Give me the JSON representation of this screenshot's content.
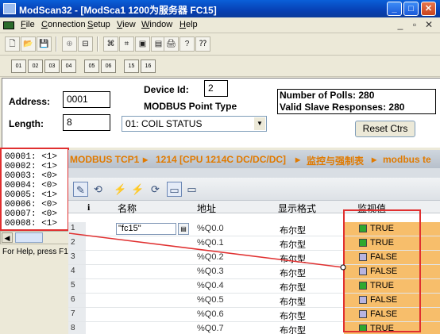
{
  "modscan": {
    "title": "ModScan32 - [ModSca1 1200为服务器 FC15]",
    "window_buttons": {
      "minimize": "_",
      "maximize": "□",
      "close": "✕"
    },
    "menu": [
      "File",
      "Connection",
      "Setup",
      "View",
      "Window",
      "Help"
    ],
    "mdi_controls": [
      "_",
      "▫",
      "✕"
    ],
    "toolbar1": [
      "🗋",
      "📂",
      "💾",
      "⊕",
      "⊟",
      "⌘",
      "⌗",
      "▣",
      "▤",
      "🖨",
      "?",
      "⁇"
    ],
    "toolbar2": [
      "01",
      "02",
      "03",
      "04",
      "05",
      "06",
      "15",
      "16"
    ],
    "address_label": "Address:",
    "address_value": "0001",
    "length_label": "Length:",
    "length_value": "8",
    "device_id_label": "Device Id:",
    "device_id_value": "2",
    "point_type_label": "MODBUS Point Type",
    "point_type_value": "01: COIL STATUS",
    "polls_label": "Number of Polls: 280",
    "valid_label": "Valid Slave Responses: 280",
    "reset_label": "Reset Ctrs",
    "coils": [
      "00001: <1>",
      "00002: <1>",
      "00003: <0>",
      "00004: <0>",
      "00005: <1>",
      "00006: <0>",
      "00007: <0>",
      "00008: <1>"
    ],
    "status_text": "For Help, press F1"
  },
  "tia": {
    "breadcrumb": [
      "MODBUS TCP1",
      "▸",
      "1214 [CPU 1214C DC/DC/DC]",
      "▸",
      "监控与强制表",
      "▸",
      "modbus te"
    ],
    "toolbar_icons": [
      "✎",
      "⟲",
      "⚡",
      "⚡",
      "⟳",
      "▭",
      "▭"
    ],
    "headers": {
      "info": "i",
      "name": "名称",
      "address": "地址",
      "format": "显示格式",
      "monitor": "监视值"
    },
    "rows": [
      {
        "index": "1",
        "name": "\"fc15\"",
        "address": "%Q0.0",
        "format": "布尔型",
        "value": "TRUE",
        "state": "on"
      },
      {
        "index": "2",
        "name": "",
        "address": "%Q0.1",
        "format": "布尔型",
        "value": "TRUE",
        "state": "on"
      },
      {
        "index": "3",
        "name": "",
        "address": "%Q0.2",
        "format": "布尔型",
        "value": "FALSE",
        "state": "off"
      },
      {
        "index": "4",
        "name": "",
        "address": "%Q0.3",
        "format": "布尔型",
        "value": "FALSE",
        "state": "off"
      },
      {
        "index": "5",
        "name": "",
        "address": "%Q0.4",
        "format": "布尔型",
        "value": "TRUE",
        "state": "on"
      },
      {
        "index": "6",
        "name": "",
        "address": "%Q0.5",
        "format": "布尔型",
        "value": "FALSE",
        "state": "off"
      },
      {
        "index": "7",
        "name": "",
        "address": "%Q0.6",
        "format": "布尔型",
        "value": "FALSE",
        "state": "off"
      },
      {
        "index": "8",
        "name": "",
        "address": "%Q0.7",
        "format": "布尔型",
        "value": "TRUE",
        "state": "on"
      }
    ],
    "colors": {
      "on": "#2ea82e",
      "off": "#b8b4e0",
      "monitor_bg": "#f7be6b",
      "annotation": "#e03030"
    }
  }
}
